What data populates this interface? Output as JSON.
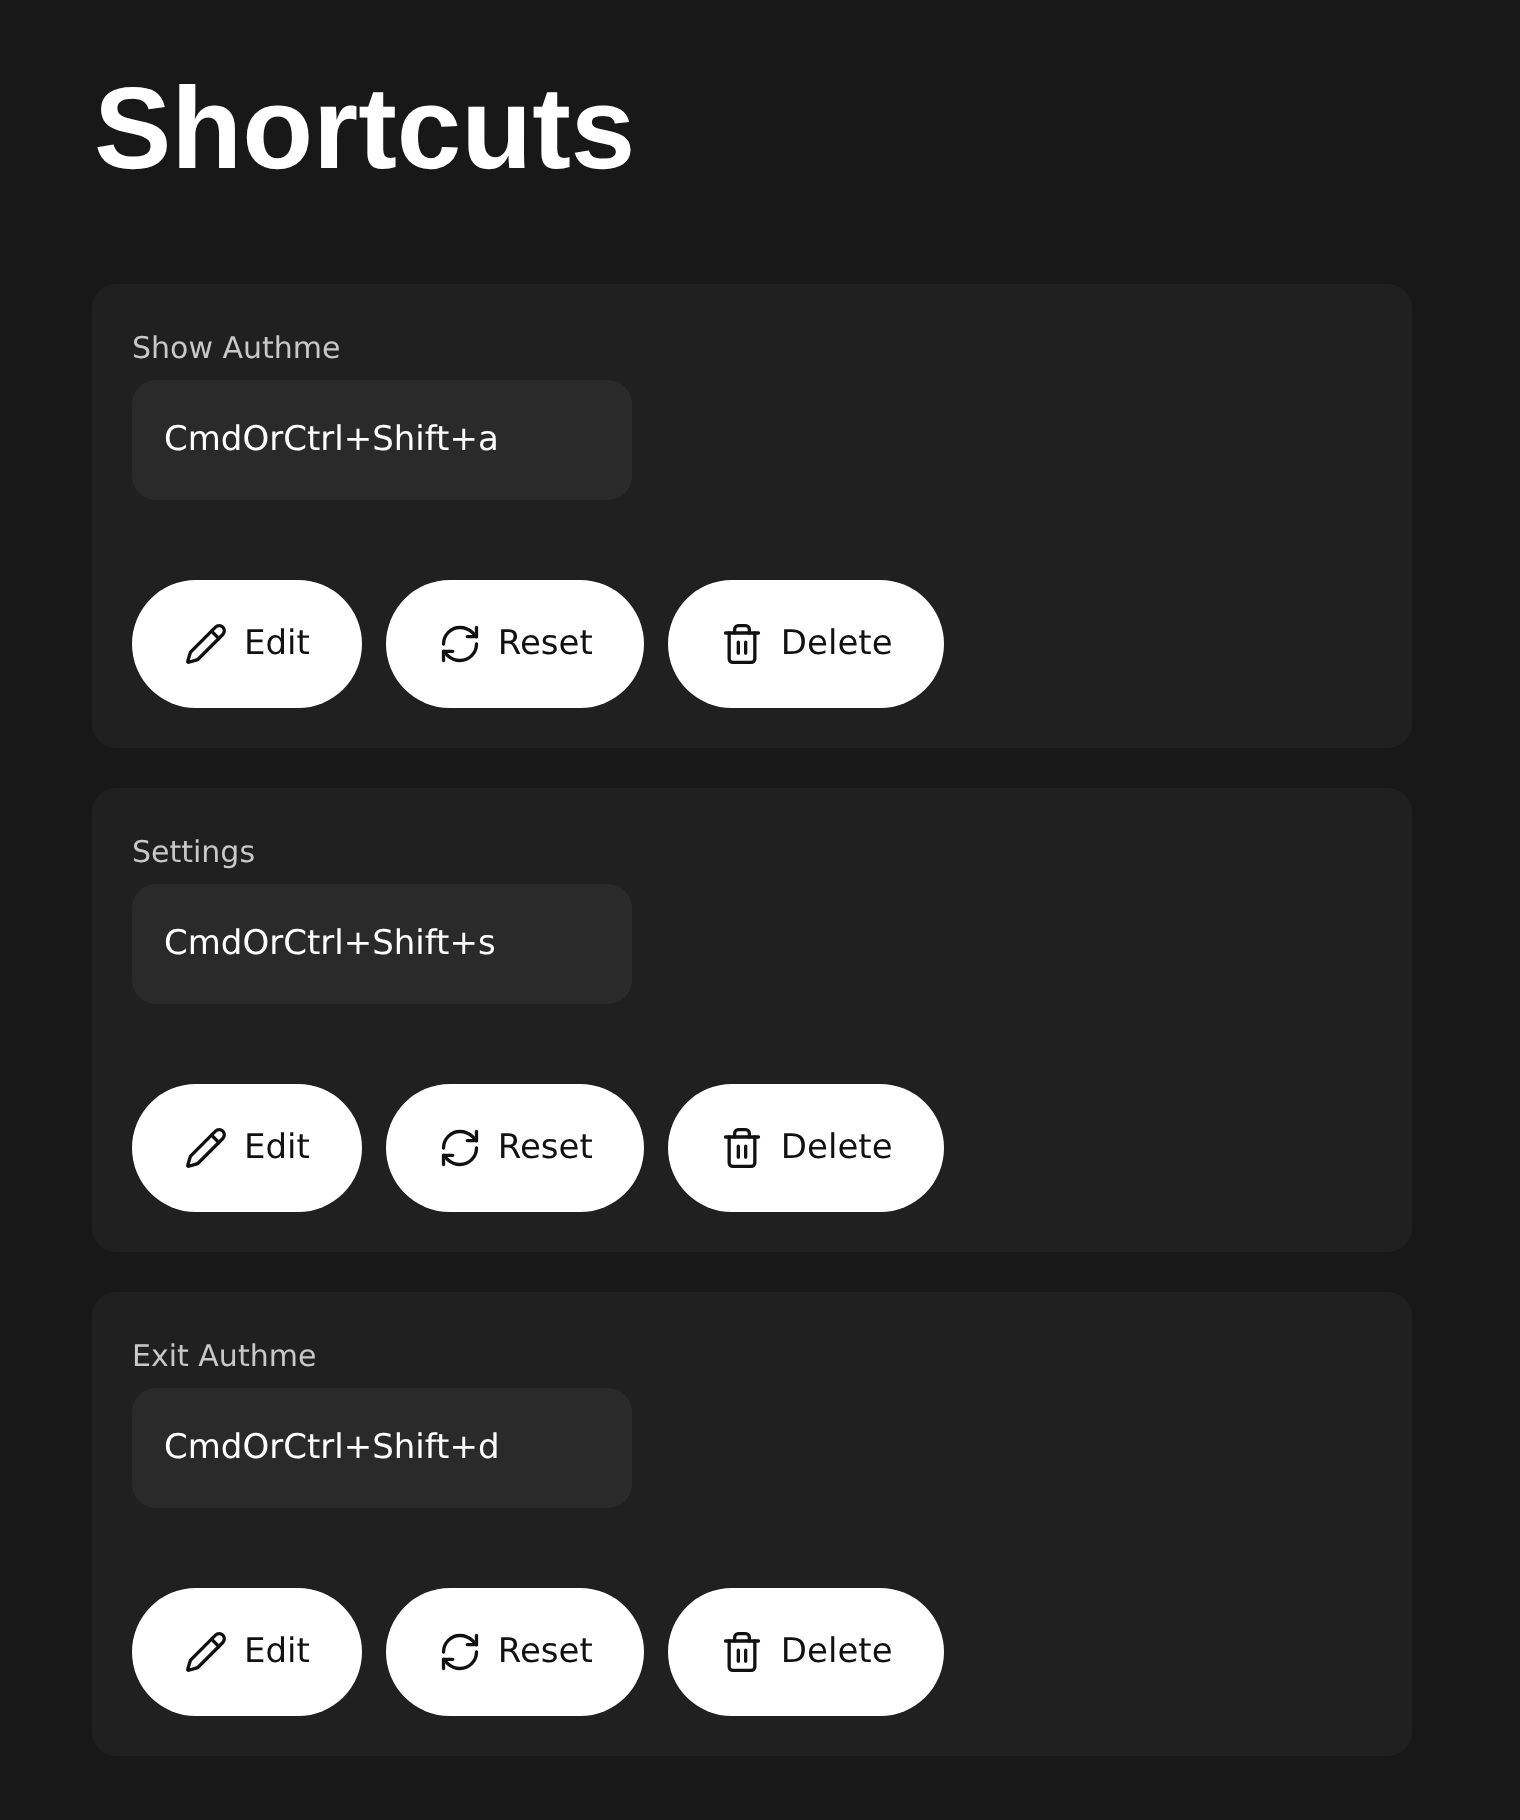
{
  "title": "Shortcuts",
  "shortcuts": [
    {
      "label": "Show Authme",
      "value": "CmdOrCtrl+Shift+a",
      "buttons": [
        {
          "kind": "edit",
          "label": "Edit"
        },
        {
          "kind": "reset",
          "label": "Reset"
        },
        {
          "kind": "delete",
          "label": "Delete"
        }
      ]
    },
    {
      "label": "Settings",
      "value": "CmdOrCtrl+Shift+s",
      "buttons": [
        {
          "kind": "edit",
          "label": "Edit"
        },
        {
          "kind": "reset",
          "label": "Reset"
        },
        {
          "kind": "delete",
          "label": "Delete"
        }
      ]
    },
    {
      "label": "Exit Authme",
      "value": "CmdOrCtrl+Shift+d",
      "buttons": [
        {
          "kind": "edit",
          "label": "Edit"
        },
        {
          "kind": "reset",
          "label": "Reset"
        },
        {
          "kind": "delete",
          "label": "Delete"
        }
      ]
    }
  ]
}
